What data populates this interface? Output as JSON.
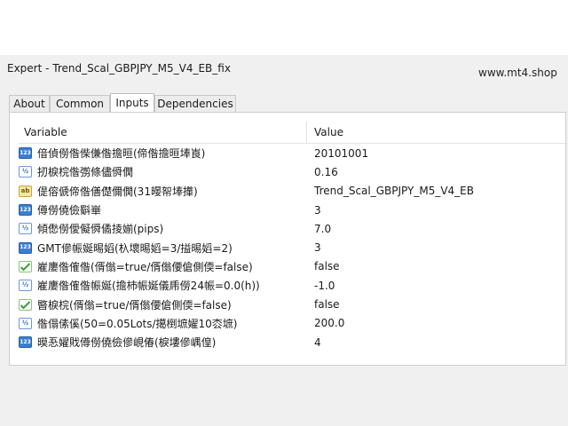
{
  "window": {
    "title": "Expert - Trend_Scal_GBPJPY_M5_V4_EB_fix",
    "watermark": "www.mt4.shop"
  },
  "tabs": [
    {
      "label": "About",
      "active": false
    },
    {
      "label": "Common",
      "active": false
    },
    {
      "label": "Inputs",
      "active": true
    },
    {
      "label": "Dependencies",
      "active": false
    }
  ],
  "table": {
    "headers": {
      "variable": "Variable",
      "value": "Value"
    },
    "rows": [
      {
        "icon": "int-type-icon",
        "variable": "偣偵僗偺偨傔偺擔晅(偙偺擔晅埲崀)",
        "value": "20101001"
      },
      {
        "icon": "double-type-icon",
        "variable": "扨棙梡偺彅條儘僢僩",
        "value": "0.16"
      },
      {
        "icon": "string-type-icon",
        "variable": "偍傛傂偙偺僐儊儞僩(31暥帤埲撪)",
        "value": "Trend_Scal_GBPJPY_M5_V4_EB"
      },
      {
        "icon": "int-type-icon",
        "variable": "僔僗僥儉斣崋",
        "value": "3"
      },
      {
        "icon": "double-type-icon",
        "variable": "傾僽僗僾儗僢僪掕媊(pips)",
        "value": "7.0"
      },
      {
        "icon": "int-type-icon",
        "variable": "GMT傪帪娫晹嫍(杁壞晹嫍=3/搤晹嫍=2)",
        "value": "3"
      },
      {
        "icon": "bool-type-icon",
        "variable": "嵟廔偺傕偺(偦傟=true/偦傟偠傖側偄=false)",
        "value": "false"
      },
      {
        "icon": "double-type-icon",
        "variable": "嵟廔偺傕偺帪娫(擔杮帪娫儀乕僗24帪=0.0(h))",
        "value": "-1.0"
      },
      {
        "icon": "bool-type-icon",
        "variable": "暋棙梡(偦傟=true/偦傟偠傖側偄=false)",
        "value": "false"
      },
      {
        "icon": "double-type-icon",
        "variable": "偺傝傃傒(50=0.05Lots/擖椡墌嬥10枩墌)",
        "value": "200.0"
      },
      {
        "icon": "int-type-icon",
        "variable": "暯忢嬥戝僔僗僥儉傪峴偆(棙塿傪嵎偟)",
        "value": "4"
      }
    ]
  }
}
